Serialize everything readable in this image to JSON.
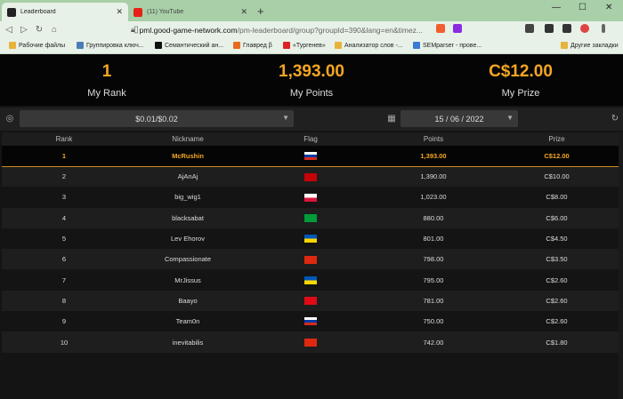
{
  "browser": {
    "tabs": [
      {
        "title": "Leaderboard",
        "active": true,
        "icon": "gg-icon"
      },
      {
        "title": "(11) YouTube",
        "active": false,
        "icon": "youtube-icon"
      }
    ],
    "url_host": "pml.good-game-network.com",
    "url_path": "/pm-leaderboard/group?groupId=390&lang=en&timez...",
    "bookmarks": [
      "Рабочие файлы",
      "Группировка ключ...",
      "Семантический ан...",
      "Главред β",
      "«Тургенев»",
      "Анализатор слов -...",
      "SEMparser - прове...",
      "Другие закладки"
    ]
  },
  "stats": {
    "rank_value": "1",
    "rank_label": "My Rank",
    "points_value": "1,393.00",
    "points_label": "My Points",
    "prize_value": "C$12.00",
    "prize_label": "My Prize"
  },
  "filters": {
    "stakes": "$0.01/$0.02",
    "date": "15 / 06 / 2022"
  },
  "table": {
    "headers": [
      "Rank",
      "Nickname",
      "Flag",
      "Points",
      "Prize"
    ],
    "rows": [
      {
        "rank": "1",
        "nick": "McRushin",
        "flag": "ru",
        "points": "1,393.00",
        "prize": "C$12.00",
        "me": true
      },
      {
        "rank": "2",
        "nick": "AjAnAj",
        "flag": "me",
        "points": "1,390.00",
        "prize": "C$10.00"
      },
      {
        "rank": "3",
        "nick": "big_wig1",
        "flag": "pl",
        "points": "1,023.00",
        "prize": "C$8.00"
      },
      {
        "rank": "4",
        "nick": "blacksabat",
        "flag": "br",
        "points": "880.00",
        "prize": "C$6.00"
      },
      {
        "rank": "5",
        "nick": "Lev Ehorov",
        "flag": "ua",
        "points": "801.00",
        "prize": "C$4.50"
      },
      {
        "rank": "6",
        "nick": "Compassionate",
        "flag": "cn",
        "points": "798.00",
        "prize": "C$3.50"
      },
      {
        "rank": "7",
        "nick": "MrJissus",
        "flag": "ua",
        "points": "795.00",
        "prize": "C$2.60"
      },
      {
        "rank": "8",
        "nick": "Baayo",
        "flag": "tr",
        "points": "781.00",
        "prize": "C$2.60"
      },
      {
        "rank": "9",
        "nick": "Team0n",
        "flag": "ru",
        "points": "750.00",
        "prize": "C$2.60"
      },
      {
        "rank": "10",
        "nick": "inevitabilis",
        "flag": "cn",
        "points": "742.00",
        "prize": "C$1.80"
      }
    ]
  },
  "colors": {
    "accent": "#f5a623"
  }
}
